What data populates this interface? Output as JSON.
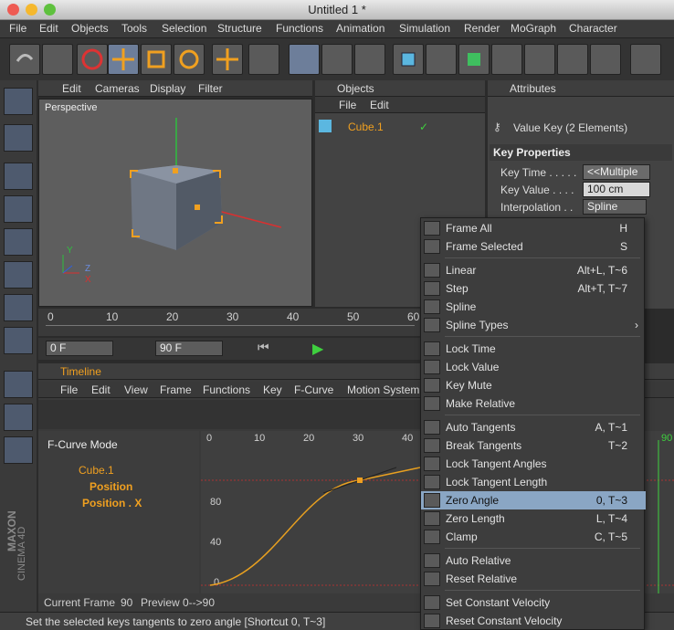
{
  "window": {
    "title": "Untitled 1 *"
  },
  "menubar": [
    "File",
    "Edit",
    "Objects",
    "Tools",
    "Selection",
    "Structure",
    "Functions",
    "Animation",
    "Simulation",
    "Render",
    "MoGraph",
    "Character"
  ],
  "viewport": {
    "menu": [
      "Edit",
      "Cameras",
      "Display",
      "Filter"
    ],
    "label": "Perspective",
    "axes": {
      "y": "Y",
      "z": "Z",
      "x": "X"
    }
  },
  "objects": {
    "title": "Objects",
    "menu": [
      "File",
      "Edit"
    ],
    "item": "Cube.1"
  },
  "attributes": {
    "title": "Attributes",
    "header": "Value Key (2 Elements)",
    "section": "Key Properties",
    "rows": [
      {
        "label": "Key Time . . . . .",
        "value": "<<Multiple"
      },
      {
        "label": "Key Value . . . .",
        "value": "100 cm"
      },
      {
        "label": "Interpolation . .",
        "value": "Spline"
      }
    ]
  },
  "ruler": {
    "ticks": [
      "0",
      "10",
      "20",
      "30",
      "40",
      "50",
      "60"
    ]
  },
  "transport": {
    "start": "0 F",
    "end": "90 F"
  },
  "timeline": {
    "title": "Timeline",
    "menu": [
      "File",
      "Edit",
      "View",
      "Frame",
      "Functions",
      "Key",
      "F-Curve",
      "Motion System"
    ],
    "mode": "F-Curve Mode",
    "tracks": [
      "Cube.1",
      "Position",
      "Position . X"
    ],
    "ticks": [
      "0",
      "10",
      "20",
      "30",
      "40"
    ],
    "marker": "90",
    "yticks": [
      "80",
      "40",
      "0"
    ],
    "footer": {
      "current_label": "Current Frame",
      "current": "90",
      "preview_label": "Preview",
      "preview": "0-->90"
    },
    "logo": [
      "MAXON",
      "CINEMA 4D"
    ]
  },
  "status": "Set the selected keys tangents to zero angle [Shortcut 0, T~3]",
  "context_menu": [
    {
      "label": "Frame All",
      "shortcut": "H"
    },
    {
      "label": "Frame Selected",
      "shortcut": "S"
    },
    {
      "sep": true
    },
    {
      "label": "Linear",
      "shortcut": "Alt+L, T~6"
    },
    {
      "label": "Step",
      "shortcut": "Alt+T, T~7"
    },
    {
      "label": "Spline",
      "shortcut": ""
    },
    {
      "label": "Spline Types",
      "shortcut": "",
      "submenu": true
    },
    {
      "sep": true
    },
    {
      "label": "Lock Time",
      "shortcut": ""
    },
    {
      "label": "Lock Value",
      "shortcut": ""
    },
    {
      "label": "Key Mute",
      "shortcut": ""
    },
    {
      "label": "Make Relative",
      "shortcut": ""
    },
    {
      "sep": true
    },
    {
      "label": "Auto Tangents",
      "shortcut": "A, T~1"
    },
    {
      "label": "Break Tangents",
      "shortcut": "T~2"
    },
    {
      "label": "Lock Tangent Angles",
      "shortcut": ""
    },
    {
      "label": "Lock Tangent Length",
      "shortcut": ""
    },
    {
      "label": "Zero Angle",
      "shortcut": "0, T~3",
      "selected": true
    },
    {
      "label": "Zero Length",
      "shortcut": "L, T~4"
    },
    {
      "label": "Clamp",
      "shortcut": "C, T~5"
    },
    {
      "sep": true
    },
    {
      "label": "Auto Relative",
      "shortcut": ""
    },
    {
      "label": "Reset Relative",
      "shortcut": ""
    },
    {
      "sep": true
    },
    {
      "label": "Set Constant Velocity",
      "shortcut": ""
    },
    {
      "label": "Reset Constant Velocity",
      "shortcut": ""
    }
  ],
  "colors": {
    "accent": "#f0a020",
    "selection": "#8aa6c4",
    "curve": "#e8a020"
  }
}
